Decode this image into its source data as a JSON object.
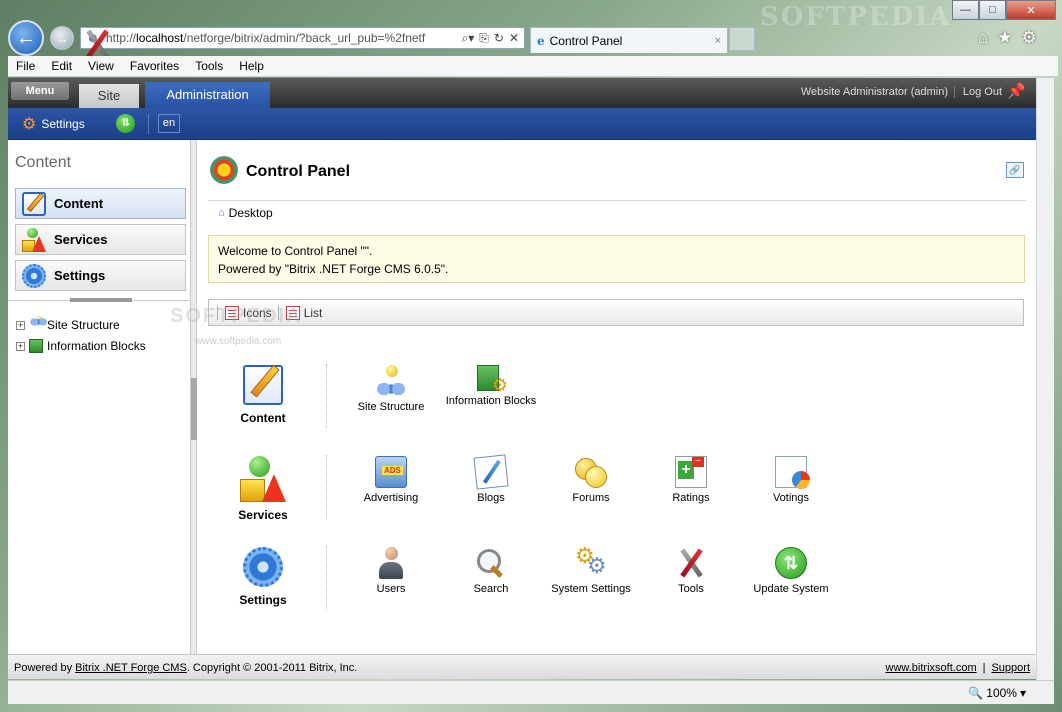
{
  "browser": {
    "url_prefix": "http://",
    "url_host": "localhost",
    "url_path": "/netforge/bitrix/admin/?back_url_pub=%2fnetf",
    "tab_title": "Control Panel",
    "tab_close": "×",
    "back": "←",
    "forward": "→",
    "win_min": "—",
    "win_max": "□",
    "win_close": "✕",
    "home": "⌂",
    "favorites": "★",
    "tools": "⚙",
    "menu": [
      "File",
      "Edit",
      "View",
      "Favorites",
      "Tools",
      "Help"
    ],
    "watermark": "SOFTPEDIA"
  },
  "admin": {
    "menu_tab": "Menu",
    "site_tab": "Site",
    "admin_tab": "Administration",
    "user": "Website Administrator (admin)",
    "logout": "Log Out",
    "settings": "Settings",
    "lang": "en"
  },
  "left": {
    "title": "Content",
    "buttons": [
      {
        "label": "Content",
        "icon": "pencil-icon"
      },
      {
        "label": "Services",
        "icon": "services-icon"
      },
      {
        "label": "Settings",
        "icon": "settings-icon"
      }
    ],
    "tree": [
      "Site Structure",
      "Information Blocks"
    ]
  },
  "main": {
    "title": "Control Panel",
    "breadcrumb": "Desktop",
    "welcome_line1": "Welcome to Control Panel \"\".",
    "welcome_line2": "Powered by \"Bitrix .NET Forge CMS 6.0.5\".",
    "view_icons": "Icons",
    "view_list": "List",
    "groups": [
      {
        "label": "Content",
        "items": [
          "Site Structure",
          "Information Blocks"
        ]
      },
      {
        "label": "Services",
        "items": [
          "Advertising",
          "Blogs",
          "Forums",
          "Ratings",
          "Votings"
        ]
      },
      {
        "label": "Settings",
        "items": [
          "Users",
          "Search",
          "System Settings",
          "Tools",
          "Update System"
        ]
      }
    ]
  },
  "footer": {
    "powered_prefix": "Powered by ",
    "powered_link": "Bitrix .NET Forge CMS",
    "copyright": ". Copyright © 2001-2011 Bitrix, Inc.",
    "site_link": "www.bitrixsoft.com",
    "sep": "|",
    "support": "Support"
  },
  "status": {
    "zoom": "100%"
  },
  "watermark_small": "www.softpedia.com"
}
